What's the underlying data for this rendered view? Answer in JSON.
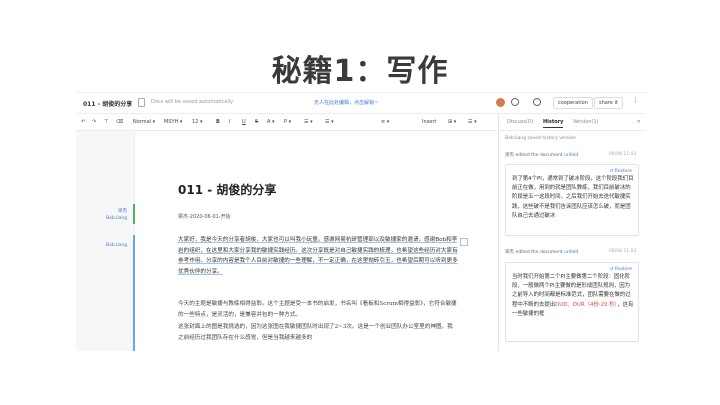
{
  "slide": {
    "title": "秘籍1：写作"
  },
  "topbar": {
    "doc_title": "011 - 胡俊的分享",
    "save_note": "Docs will be saved automatically",
    "center_link": "无人在此处编辑，点击解锁~",
    "cooperation_label": "cooperation",
    "share_label": "share it",
    "more_label": "⋮"
  },
  "toolbar": {
    "undo": "↶",
    "redo": "↷",
    "format_paint": "⊤",
    "clear": "⌫",
    "style": "Normal ▾",
    "font": "MSYH ▾",
    "size": "12 ▾",
    "bold": "B",
    "italic": "I",
    "underline": "U",
    "strike": "S",
    "color": "A ▾",
    "highlight": "P ▾",
    "list1": "☰ ▾",
    "list2": "☰ ▾",
    "align": "≡ ▾",
    "insert": "Insert",
    "table": "⊞ ▾",
    "more": "☰ ▾"
  },
  "gutter": {
    "note1_name": "梁杰",
    "note1_user": "Bob.liang",
    "note2_user": "Bob.liang"
  },
  "document": {
    "heading": "011 - 胡俊的分享",
    "meta": "梁杰-2020-06-01-开始",
    "para1": "大家好，我是今天的分享者胡俊，大家也可以叫我小玩童。感谢网易杭研管理部以及敏捷家的邀请，感谢Bob和李岩的组织，在这里和大家分享我的敏捷实践经历。这次分享既是对自己敏捷实践的梳理，也希望这些经历对大家有参考作用。分享的内容是我个人目前对敏捷的一些理解，不一定正确，在这里抛砖引玉，也希望后期可以听到更多优秀伙伴的分享。",
    "para2": "今天的主题是敏捷与教练相得益彰。这个主题是受一本书的启发，书名叫《看板和Scrum相得益彰》，它符合敏捷的一些特点，是灵活的，是兼容并包的一种方式。",
    "para3": "这张封面上的图是我挑选的，因为这张图在我敏捷团队时出现了2~3次。这是一个创业团队办公室里的神图。我之前经历过我团队存在什么感觉，但是当我越来越多的"
  },
  "panel": {
    "tab_discussion": "Discuss(0)",
    "tab_history": "History",
    "tab_version": "Version(1)",
    "close": "✕",
    "saved_note": "Bob.liang saved history version",
    "edit1_user": "梁杰",
    "edit1_action": "edited the document",
    "edit1_unfold": "unfold",
    "edit1_time": "06/08 11:03",
    "edit2_user": "梁杰",
    "edit2_action": "edited the document",
    "edit2_unfold": "unfold",
    "edit2_time": "06/08 11:03",
    "card1_restore": "↺ Restore",
    "card1_text": "到了第4个PI，通常到了破冰阶段，这个阶段我们目前正在做，用到的就是团队教练，我们目前破冰的阶段是五一这段时间，之后我们开始去迭代敏捷实践，这些破不是我们告诉团队应该怎么破，而是团队自己去通过破冰",
    "card2_restore": "↺ Restore",
    "card2_text_a": "当时我们开始第二个PI主要做第二个阶段：固化阶段，一般做两个PI主要做的是形成团队规则，因为之前导入的时间都是标准范式，团队需要在做的过程中不断的去提出",
    "card2_red1": "DUD、DUR（4份·20 秒）",
    "card2_text_b": "，这有一些敏捷的框"
  }
}
